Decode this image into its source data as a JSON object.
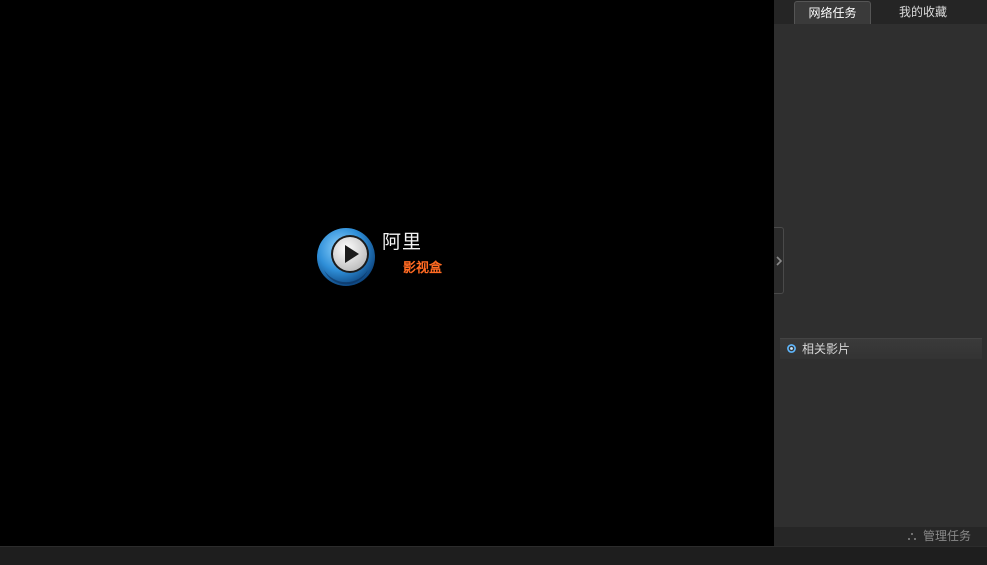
{
  "player": {
    "logo": {
      "name": "阿里",
      "subtitle": "影视盒",
      "mark_icon": "play-circle-icon"
    }
  },
  "sidebar": {
    "tabs": [
      {
        "label": "网络任务",
        "active": true
      },
      {
        "label": "我的收藏",
        "active": false
      }
    ],
    "collapse_icon": "chevron-right-icon",
    "related": {
      "label": "相关影片",
      "icon": "bullet-ring-icon"
    },
    "footer": {
      "manage_label": "管理任务",
      "manage_icon": "dots-icon"
    }
  },
  "colors": {
    "background": "#000000",
    "sidebar": "#2f2f2f",
    "accent_orange": "#ff6a22",
    "accent_blue": "#2f8fd8"
  }
}
